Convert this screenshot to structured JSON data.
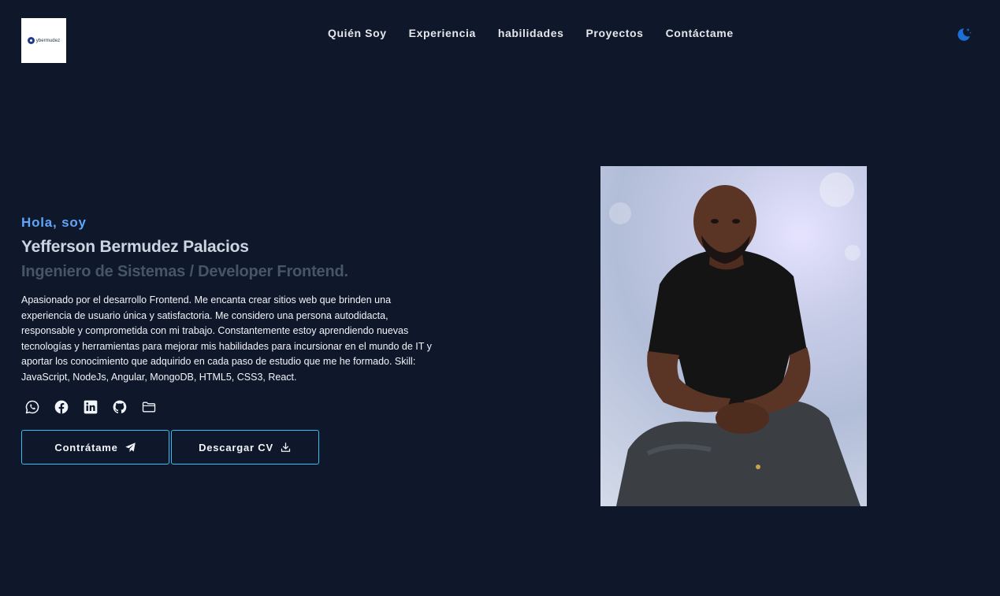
{
  "header": {
    "logo_text": "ybermudez",
    "nav": [
      {
        "label": "Quién Soy"
      },
      {
        "label": "Experiencia"
      },
      {
        "label": "habilidades"
      },
      {
        "label": "Proyectos"
      },
      {
        "label": "Contáctame"
      }
    ],
    "theme_icon": "moon-stars-icon"
  },
  "hero": {
    "greeting": "Hola, soy",
    "name": "Yefferson Bermudez Palacios",
    "role": "Ingeniero de Sistemas / Developer Frontend.",
    "bio": "Apasionado por el desarrollo Frontend. Me encanta crear sitios web que brinden una experiencia de usuario única y satisfactoria. Me considero una persona autodidacta, responsable y comprometida con mi trabajo. Constantemente estoy aprendiendo nuevas tecnologías y herramientas para mejorar mis habilidades para incursionar en el mundo de IT y aportar los conocimiento que adquirido en cada paso de estudio que me he formado. Skill: JavaScript, NodeJs, Angular, MongoDB, HTML5, CSS3, React.",
    "socials": [
      "whatsapp-icon",
      "facebook-icon",
      "linkedin-icon",
      "github-icon",
      "folder-icon"
    ],
    "buttons": {
      "hire_label": "Contrátame",
      "cv_label": "Descargar CV"
    }
  },
  "colors": {
    "background": "#0f172a",
    "accent": "#38bdf8",
    "greeting": "#60a5fa",
    "role": "#475569"
  }
}
